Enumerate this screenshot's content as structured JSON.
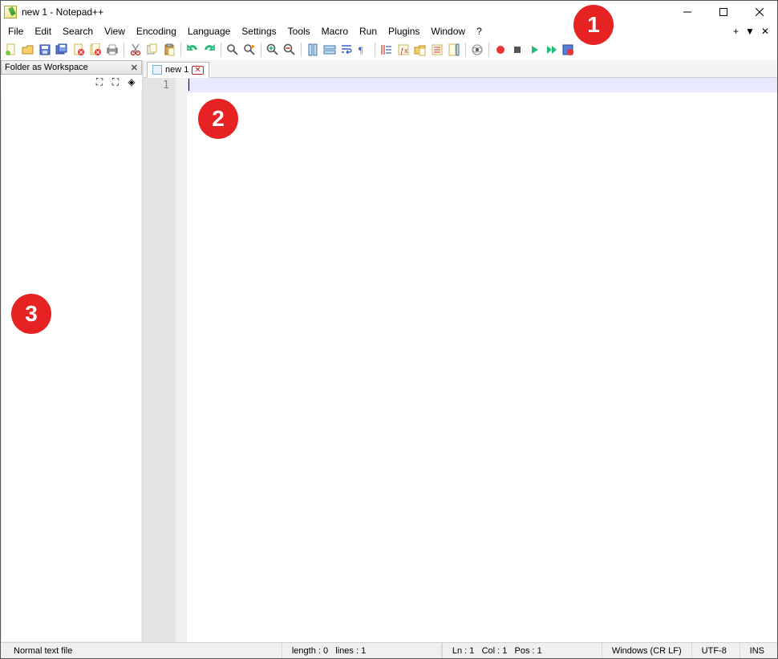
{
  "window": {
    "title": "new 1 - Notepad++"
  },
  "menu": {
    "items": [
      "File",
      "Edit",
      "Search",
      "View",
      "Encoding",
      "Language",
      "Settings",
      "Tools",
      "Macro",
      "Run",
      "Plugins",
      "Window",
      "?"
    ],
    "right": {
      "plus": "+",
      "down": "▼",
      "close": "✕"
    }
  },
  "toolbar": {
    "names": [
      "new-file",
      "open-file",
      "save",
      "save-all",
      "close",
      "close-all",
      "print",
      "sep",
      "cut",
      "copy",
      "paste",
      "sep",
      "undo",
      "redo",
      "sep",
      "find",
      "replace",
      "sep",
      "zoom-in",
      "zoom-out",
      "sep",
      "sync-v",
      "sync-h",
      "word-wrap",
      "show-all",
      "sep",
      "indent-guide",
      "lang-user",
      "folder-doc",
      "function-list",
      "doc-map",
      "sep",
      "monitor-file",
      "sep",
      "record-macro",
      "stop-macro",
      "play-macro",
      "play-multi",
      "save-macro"
    ]
  },
  "sidebar": {
    "title": "Folder as Workspace",
    "tools": [
      "expand",
      "collapse",
      "locate"
    ]
  },
  "tabs": {
    "items": [
      {
        "label": "new 1"
      }
    ]
  },
  "editor": {
    "line_number": "1"
  },
  "status": {
    "filetype": "Normal text file",
    "length": "length : 0",
    "lines": "lines : 1",
    "ln": "Ln : 1",
    "col": "Col : 1",
    "pos": "Pos : 1",
    "eol": "Windows (CR LF)",
    "encoding": "UTF-8",
    "mode": "INS"
  },
  "annotations": {
    "a1": "1",
    "a2": "2",
    "a3": "3"
  }
}
